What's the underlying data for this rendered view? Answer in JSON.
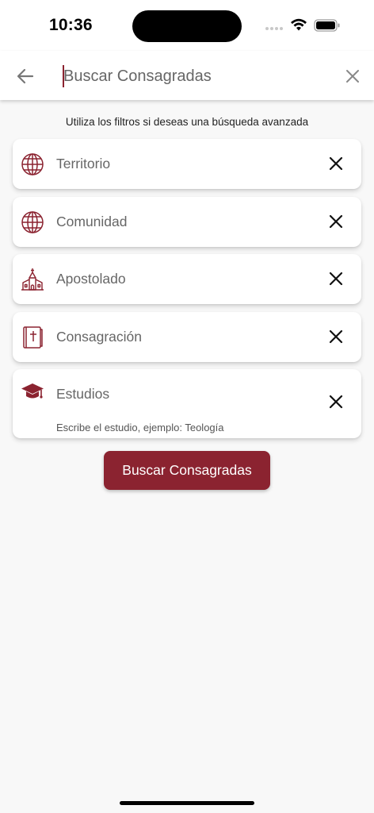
{
  "status_bar": {
    "time": "10:36"
  },
  "search": {
    "placeholder": "Buscar Consagradas",
    "value": ""
  },
  "hint": "Utiliza los filtros si deseas una búsqueda avanzada",
  "filters": [
    {
      "label": "Territorio",
      "icon": "globe-icon"
    },
    {
      "label": "Comunidad",
      "icon": "globe-icon"
    },
    {
      "label": "Apostolado",
      "icon": "church-icon"
    },
    {
      "label": "Consagración",
      "icon": "bible-icon"
    },
    {
      "label": "Estudios",
      "icon": "graduation-cap-icon",
      "helper": "Escribe el estudio, ejemplo: Teología"
    }
  ],
  "search_button": {
    "label": "Buscar Consagradas"
  },
  "colors": {
    "accent": "#8b2330",
    "background": "#f8f8f8"
  }
}
